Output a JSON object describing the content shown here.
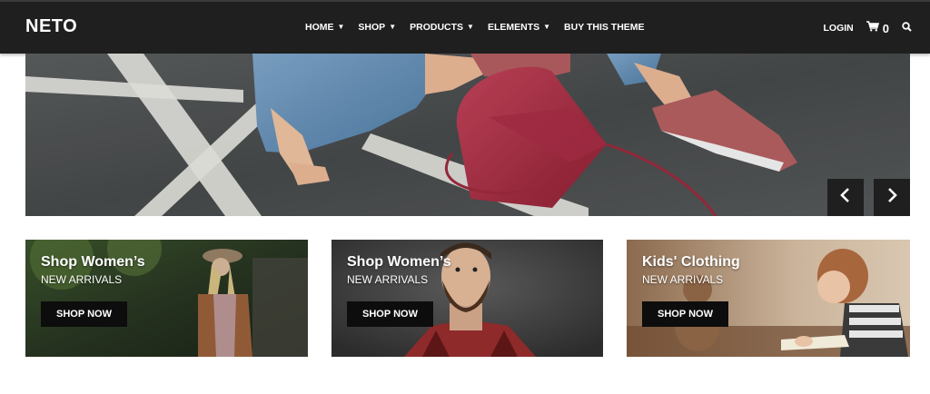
{
  "header": {
    "logo": "NETO",
    "nav": [
      {
        "label": "HOME",
        "has_dropdown": true
      },
      {
        "label": "SHOP",
        "has_dropdown": true
      },
      {
        "label": "PRODUCTS",
        "has_dropdown": true
      },
      {
        "label": "ELEMENTS",
        "has_dropdown": true
      },
      {
        "label": "BUY THIS THEME",
        "has_dropdown": false
      }
    ],
    "login": "LOGIN",
    "cart_count": "0",
    "icons": {
      "cart": "cart-icon",
      "search": "search-icon",
      "caret": "chevron-down-icon"
    }
  },
  "hero": {
    "prev_icon": "chevron-left-icon",
    "next_icon": "chevron-right-icon"
  },
  "promos": [
    {
      "title": "Shop Women’s",
      "subtitle": "NEW ARRIVALS",
      "button": "SHOP NOW"
    },
    {
      "title": "Shop Women’s",
      "subtitle": "NEW ARRIVALS",
      "button": "SHOP NOW"
    },
    {
      "title": "Kids' Clothing",
      "subtitle": "NEW ARRIVALS",
      "button": "SHOP NOW"
    }
  ],
  "colors": {
    "header_bg": "#1f1f1f",
    "button_bg": "#0d0d0d",
    "text_light": "#ffffff"
  }
}
